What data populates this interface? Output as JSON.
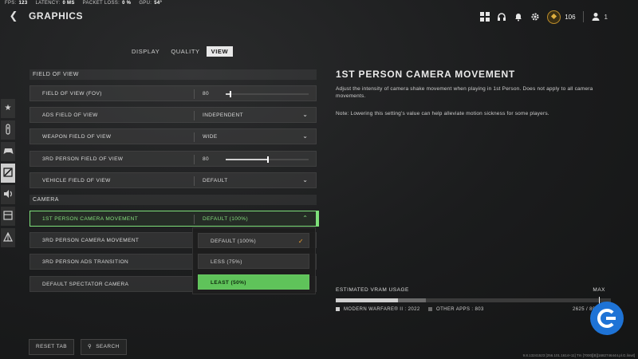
{
  "stats": [
    {
      "label": "FPS:",
      "value": "123"
    },
    {
      "label": "LATENCY:",
      "value": "0 MS"
    },
    {
      "label": "PACKET LOSS:",
      "value": "0 %"
    },
    {
      "label": "GPU:",
      "value": "54°"
    }
  ],
  "header": {
    "title": "GRAPHICS",
    "level": "106",
    "friends": "1"
  },
  "tabs": [
    "DISPLAY",
    "QUALITY",
    "VIEW"
  ],
  "sections": {
    "fov_title": "FIELD OF VIEW",
    "camera_title": "CAMERA"
  },
  "settings": {
    "fov": {
      "label": "FIELD OF VIEW (FOV)",
      "value": "80",
      "slider_fraction": 0.05
    },
    "ads_fov": {
      "label": "ADS FIELD OF VIEW",
      "value": "INDEPENDENT"
    },
    "weapon_fov": {
      "label": "WEAPON FIELD OF VIEW",
      "value": "WIDE"
    },
    "third_fov": {
      "label": "3RD PERSON FIELD OF VIEW",
      "value": "80",
      "slider_fraction": 0.5
    },
    "vehicle_fov": {
      "label": "VEHICLE FIELD OF VIEW",
      "value": "DEFAULT"
    },
    "first_cam": {
      "label": "1ST PERSON CAMERA MOVEMENT",
      "value": "DEFAULT (100%)"
    },
    "third_cam": {
      "label": "3RD PERSON CAMERA MOVEMENT"
    },
    "third_ads": {
      "label": "3RD PERSON ADS TRANSITION"
    },
    "spectator": {
      "label": "DEFAULT SPECTATOR CAMERA"
    }
  },
  "dropdown": {
    "options": [
      "DEFAULT (100%)",
      "LESS (75%)",
      "LEAST (50%)"
    ]
  },
  "description": {
    "title": "1ST PERSON CAMERA MOVEMENT",
    "text": "Adjust the intensity of camera shake movement when playing in 1st Person. Does not apply to all camera movements.",
    "note": "Note: Lowering this setting's value can help alleviate motion sickness for some players."
  },
  "vram": {
    "title": "ESTIMATED VRAM USAGE",
    "max_label": "MAX",
    "mw_label": "MODERN WARFARE® II : 2022",
    "other_label": "OTHER APPS : 803",
    "total": "2625 / 8031 MB",
    "mw_fraction": 0.227,
    "other_fraction": 0.1
  },
  "bottom": {
    "reset": "RESET TAB",
    "search": "SEARCH"
  },
  "build": "9.8.13241523 [256.101.1614+11] Tm [7000][B][1682746444.pl.G.linwt]",
  "colors": {
    "accent_green": "#7ee07a",
    "check_orange": "#f0a030",
    "logo_blue": "#1e73d6"
  }
}
